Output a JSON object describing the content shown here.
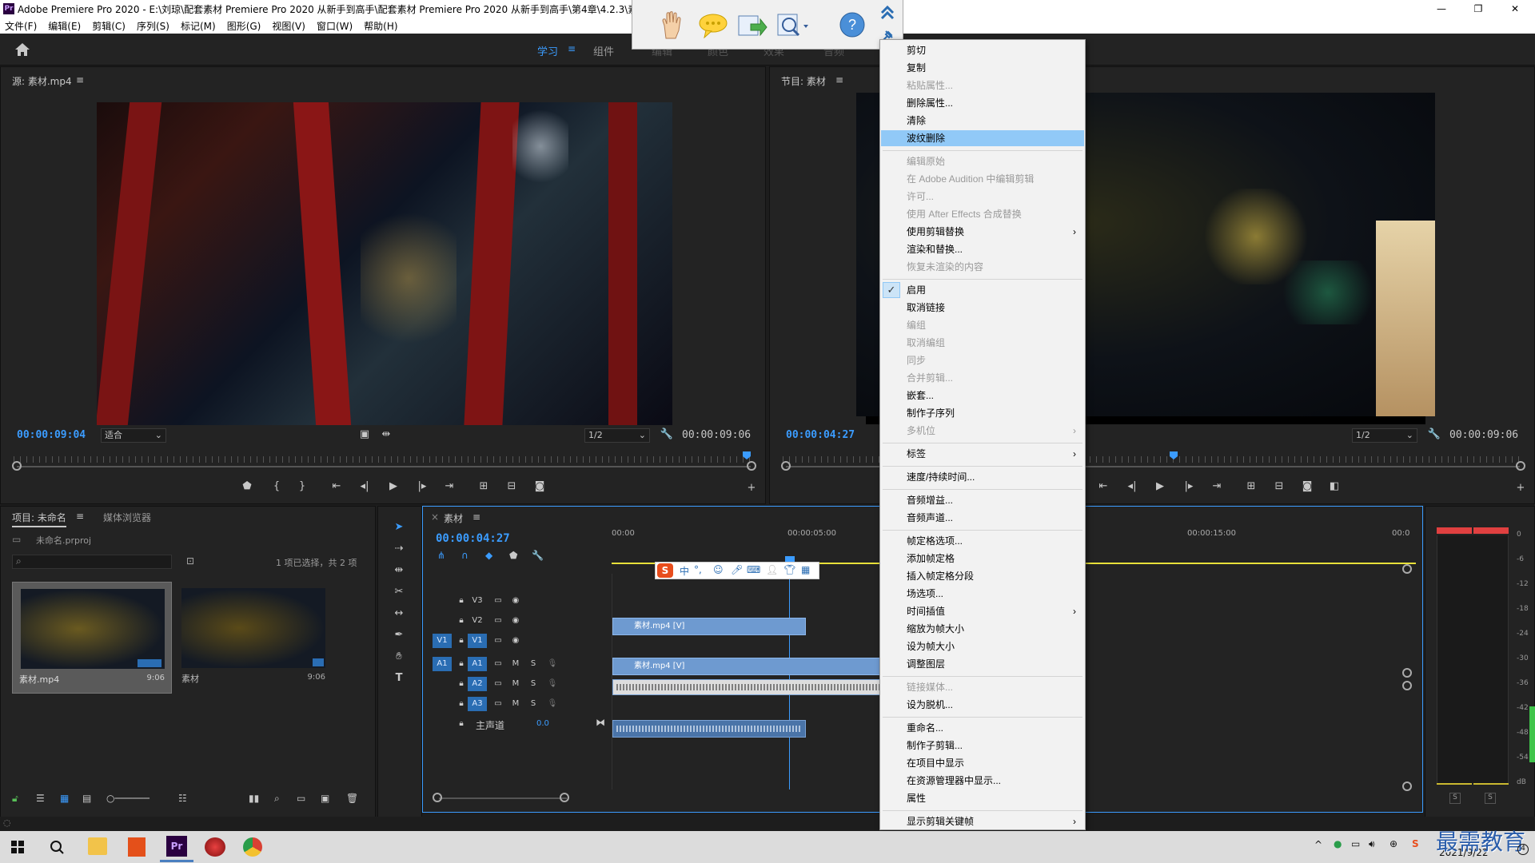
{
  "window": {
    "title": "Adobe Premiere Pro 2020 - E:\\刘琼\\配套素材 Premiere Pro 2020 从新手到高手\\配套素材 Premiere Pro 2020 从新手到高手\\第4章\\4.2.3\\素",
    "logo": "Pr",
    "minimize": "—",
    "maximize": "❐",
    "close": "✕"
  },
  "menubar": [
    "文件(F)",
    "编辑(E)",
    "剪辑(C)",
    "序列(S)",
    "标记(M)",
    "图形(G)",
    "视图(V)",
    "窗口(W)",
    "帮助(H)"
  ],
  "workspaces": {
    "learn": "学习",
    "assembly": "组件",
    "w3": "编辑",
    "w4": "颜色",
    "w5": "效果",
    "w6": "音频"
  },
  "source": {
    "title": "源: 素材.mp4",
    "timecode": "00:00:09:04",
    "fit": "适合",
    "resolution": "1/2",
    "duration": "00:00:09:06"
  },
  "program": {
    "title": "节目: 素材",
    "timecode": "00:00:04:27",
    "resolution": "1/2",
    "duration": "00:00:09:06"
  },
  "project": {
    "tab_project": "项目: 未命名",
    "tab_browser": "媒体浏览器",
    "file": "未命名.prproj",
    "selection": "1 项已选择，共 2 项",
    "items": [
      {
        "name": "素材.mp4",
        "duration": "9:06"
      },
      {
        "name": "素材",
        "duration": "9:06"
      }
    ]
  },
  "timeline": {
    "tab": "素材",
    "timecode": "00:00:04:27",
    "ruler": [
      "00:00",
      "00:00:05:00",
      "00:00:15:00",
      "00:0"
    ],
    "tracks": {
      "v3": "V3",
      "v2": "V2",
      "v1src": "V1",
      "v1": "V1",
      "a1src": "A1",
      "a1": "A1",
      "a2": "A2",
      "a3": "A3",
      "m": "M",
      "s": "S",
      "master": "主声道",
      "master_val": "0.0"
    },
    "clips": {
      "v3": "素材.mp4 [V]",
      "v1": "素材.mp4 [V]"
    }
  },
  "meter": {
    "scale": [
      "0",
      "-6",
      "-12",
      "-18",
      "-24",
      "-30",
      "-36",
      "-42",
      "-48",
      "-54",
      "dB"
    ],
    "solo": "S"
  },
  "context_menu": {
    "items": [
      {
        "label": "剪切"
      },
      {
        "label": "复制"
      },
      {
        "label": "粘贴属性...",
        "disabled": true
      },
      {
        "label": "删除属性..."
      },
      {
        "label": "清除"
      },
      {
        "label": "波纹删除",
        "highlight": true
      },
      {
        "sep": true
      },
      {
        "label": "编辑原始",
        "disabled": true
      },
      {
        "label": "在 Adobe Audition 中编辑剪辑",
        "disabled": true
      },
      {
        "label": "许可...",
        "disabled": true
      },
      {
        "label": "使用 After Effects 合成替换",
        "disabled": true
      },
      {
        "label": "使用剪辑替换",
        "submenu": true
      },
      {
        "label": "渲染和替换..."
      },
      {
        "label": "恢复未渲染的内容",
        "disabled": true
      },
      {
        "sep": true
      },
      {
        "label": "启用",
        "checked": true
      },
      {
        "label": "取消链接"
      },
      {
        "label": "编组",
        "disabled": true
      },
      {
        "label": "取消编组",
        "disabled": true
      },
      {
        "label": "同步",
        "disabled": true
      },
      {
        "label": "合并剪辑...",
        "disabled": true
      },
      {
        "label": "嵌套..."
      },
      {
        "label": "制作子序列"
      },
      {
        "label": "多机位",
        "disabled": true,
        "submenu": true
      },
      {
        "sep": true
      },
      {
        "label": "标签",
        "submenu": true
      },
      {
        "sep": true
      },
      {
        "label": "速度/持续时间..."
      },
      {
        "sep": true
      },
      {
        "label": "音频增益..."
      },
      {
        "label": "音频声道..."
      },
      {
        "sep": true
      },
      {
        "label": "帧定格选项..."
      },
      {
        "label": "添加帧定格"
      },
      {
        "label": "插入帧定格分段"
      },
      {
        "label": "场选项..."
      },
      {
        "label": "时间插值",
        "submenu": true
      },
      {
        "label": "缩放为帧大小"
      },
      {
        "label": "设为帧大小"
      },
      {
        "label": "调整图层"
      },
      {
        "sep": true
      },
      {
        "label": "链接媒体...",
        "disabled": true
      },
      {
        "label": "设为脱机..."
      },
      {
        "sep": true
      },
      {
        "label": "重命名..."
      },
      {
        "label": "制作子剪辑..."
      },
      {
        "label": "在项目中显示"
      },
      {
        "label": "在资源管理器中显示..."
      },
      {
        "label": "属性"
      },
      {
        "sep": true
      },
      {
        "label": "显示剪辑关键帧",
        "submenu": true
      }
    ]
  },
  "taskbar": {
    "date": "2021/9/22",
    "watermark": "最需教育",
    "ime": "中"
  },
  "icons": {
    "submenu": "›",
    "check": "✓"
  },
  "colors": {
    "accent": "#3b9cff",
    "highlight": "#91c9f7",
    "clip": "#6e9ad0"
  }
}
